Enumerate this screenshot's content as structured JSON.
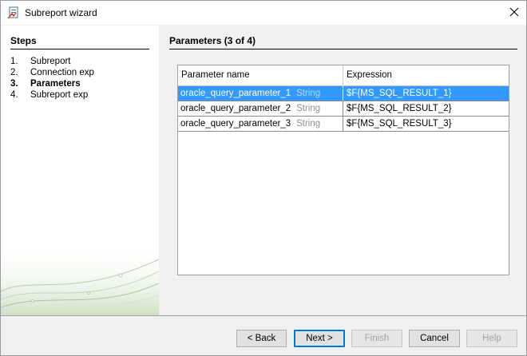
{
  "window": {
    "title": "Subreport wizard",
    "app_icon": "report-icon",
    "close_icon": "close-icon"
  },
  "steps": {
    "title": "Steps",
    "items": [
      {
        "num": "1.",
        "label": "Subreport"
      },
      {
        "num": "2.",
        "label": "Connection exp"
      },
      {
        "num": "3.",
        "label": "Parameters"
      },
      {
        "num": "4.",
        "label": "Subreport exp"
      }
    ],
    "active_index": 2
  },
  "main": {
    "title": "Parameters (3 of 4)",
    "table": {
      "columns": [
        "Parameter name",
        "Expression"
      ],
      "rows": [
        {
          "name": "oracle_query_parameter_1",
          "type": "String",
          "expression": "$F{MS_SQL_RESULT_1}",
          "selected": true
        },
        {
          "name": "oracle_query_parameter_2",
          "type": "String",
          "expression": "$F{MS_SQL_RESULT_2}",
          "selected": false
        },
        {
          "name": "oracle_query_parameter_3",
          "type": "String",
          "expression": "$F{MS_SQL_RESULT_3}",
          "selected": false
        }
      ]
    }
  },
  "buttons": {
    "back": "< Back",
    "next": "Next >",
    "finish": "Finish",
    "cancel": "Cancel",
    "help": "Help"
  },
  "colors": {
    "selection": "#3399ff",
    "accent": "#0078d7"
  }
}
